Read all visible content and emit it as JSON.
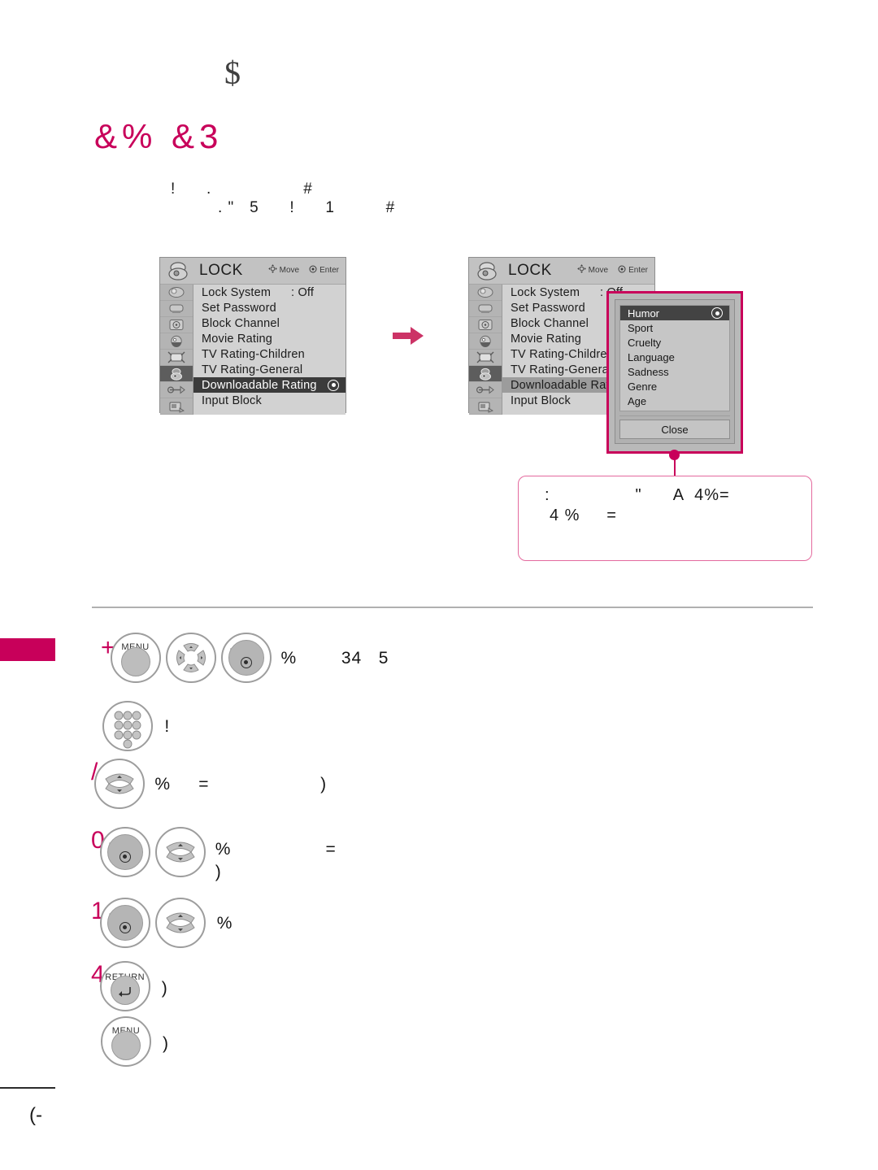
{
  "page": {
    "header_glyph": "$",
    "section_title": "&%  &3",
    "intro_line_1": "!      .                  #",
    "intro_line_2": ". \"   5      !      1          #",
    "page_number": "(-"
  },
  "colors": {
    "accent_pink": "#c8005a",
    "callout_border": "#e46a9e",
    "osd_background": "#d2d2d2",
    "osd_selected": "#3b3b3b",
    "divider_gray": "#b0b0b0"
  },
  "osd_menu": {
    "title": "LOCK",
    "hints": [
      {
        "icon": "dpad-icon",
        "label": "Move"
      },
      {
        "icon": "enter-circle-icon",
        "label": "Enter"
      }
    ],
    "side_icons": [
      "picture-icon",
      "audio-icon",
      "time-icon",
      "setup-icon",
      "option-icon",
      "lock-icon",
      "input-icon",
      "usb-icon"
    ],
    "selected_side_icon_index": 5,
    "rows": [
      {
        "label": "Lock System",
        "value": ": Off",
        "selected": false,
        "radio": false
      },
      {
        "label": "Set Password",
        "value": "",
        "selected": false,
        "radio": false
      },
      {
        "label": "Block Channel",
        "value": "",
        "selected": false,
        "radio": false
      },
      {
        "label": "Movie Rating",
        "value": "",
        "selected": false,
        "radio": false
      },
      {
        "label": "TV Rating-Children",
        "value": "",
        "selected": false,
        "radio": false
      },
      {
        "label": "TV Rating-General",
        "value": "",
        "selected": false,
        "radio": false
      },
      {
        "label": "Downloadable Rating",
        "value": "",
        "selected": true,
        "radio": true
      },
      {
        "label": "Input Block",
        "value": "",
        "selected": false,
        "radio": false
      }
    ]
  },
  "popup": {
    "items": [
      {
        "label": "Humor",
        "selected": true,
        "radio": true
      },
      {
        "label": "Sport",
        "selected": false,
        "radio": false
      },
      {
        "label": "Cruelty",
        "selected": false,
        "radio": false
      },
      {
        "label": "Language",
        "selected": false,
        "radio": false
      },
      {
        "label": "Sadness",
        "selected": false,
        "radio": false
      },
      {
        "label": "Genre",
        "selected": false,
        "radio": false
      },
      {
        "label": "Age",
        "selected": false,
        "radio": false
      }
    ],
    "close_label": "Close"
  },
  "callout": {
    "line_1": ":                \"      A  4%=",
    "line_2": "4 %     ="
  },
  "steps": [
    {
      "num": "+",
      "buttons": [
        "MENU",
        "DPAD",
        "ENTER"
      ],
      "text": "%        34   5",
      "bold_text": "34   5"
    },
    {
      "num": ",",
      "buttons": [
        "NUMPAD"
      ],
      "text": "!"
    },
    {
      "num": "/",
      "buttons": [
        "UPDOWN"
      ],
      "text": "%     =                    )"
    },
    {
      "num": "0",
      "buttons": [
        "ENTER",
        "UPDOWN"
      ],
      "text": "%                 =",
      "text2": ")"
    },
    {
      "num": "1",
      "buttons": [
        "ENTER",
        "UPDOWN"
      ],
      "text": "%"
    },
    {
      "num": "4",
      "buttons": [
        "RETURN"
      ],
      "text": ")"
    },
    {
      "num": "",
      "buttons": [
        "MENU"
      ],
      "text": ")"
    }
  ],
  "button_labels": {
    "menu": "MENU",
    "enter": "ENTER",
    "return": "RETURN"
  }
}
